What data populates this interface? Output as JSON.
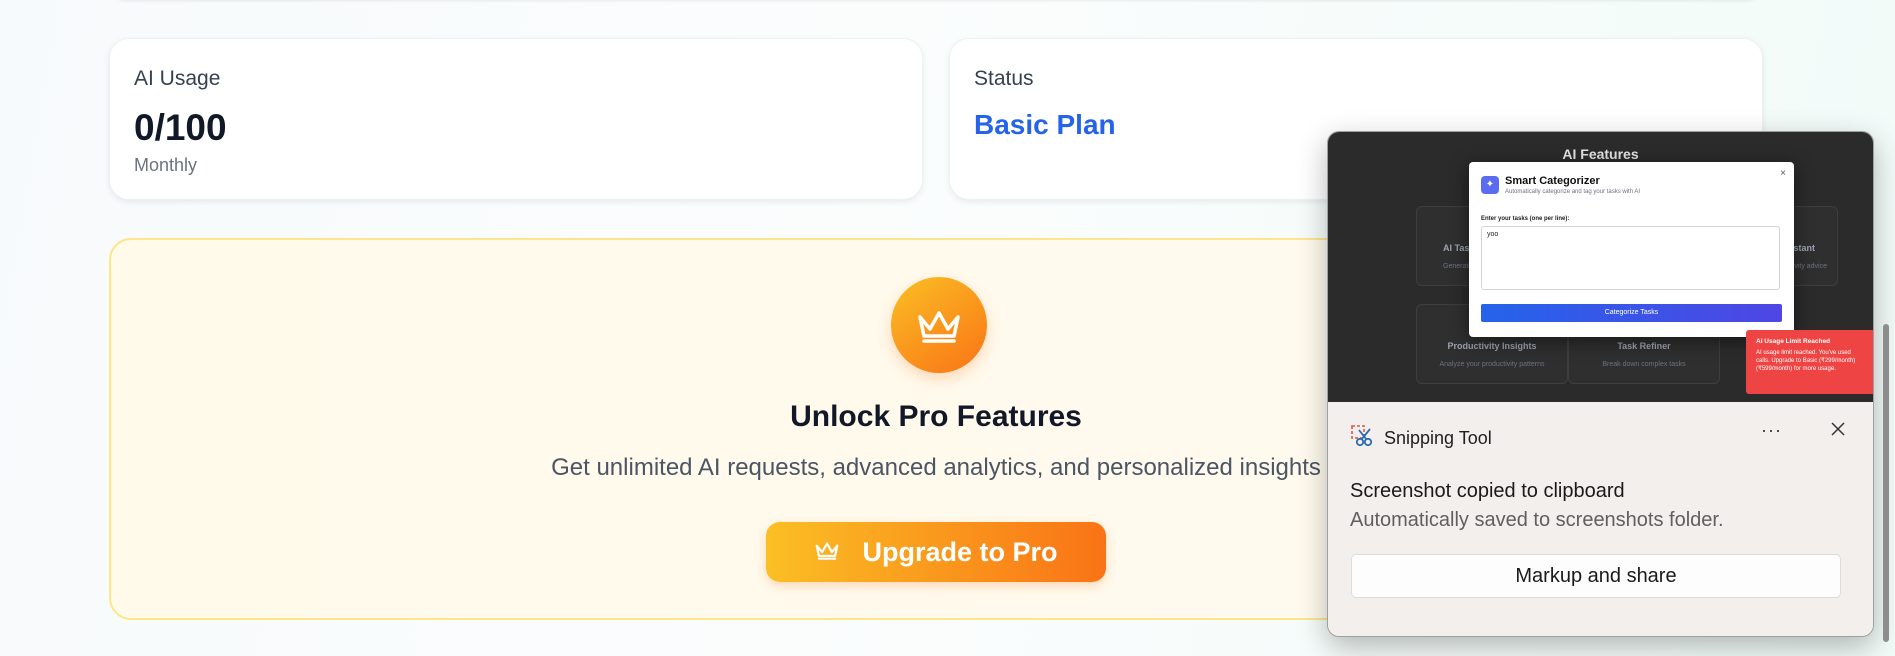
{
  "usage_card": {
    "label": "AI Usage",
    "value": "0/100",
    "period": "Monthly"
  },
  "status_card": {
    "label": "Status",
    "plan": "Basic Plan"
  },
  "promo": {
    "title": "Unlock Pro Features",
    "subtitle": "Get unlimited AI requests, advanced analytics, and personalized insights",
    "button_label": "Upgrade to Pro",
    "icon": "crown-icon",
    "accent_from": "#fbbf24",
    "accent_to": "#f97316"
  },
  "toast": {
    "app_name": "Snipping Tool",
    "more_label": "···",
    "title": "Screenshot copied to clipboard",
    "subtitle": "Automatically saved to screenshots folder.",
    "action_label": "Markup and share",
    "thumbnail": {
      "header": "AI Features",
      "modal_title": "Smart Categorizer",
      "modal_subtitle": "Automatically categorize and tag your tasks with AI",
      "modal_input_label": "Enter your tasks (one per line):",
      "modal_input_value": "yoo",
      "modal_button": "Categorize Tasks",
      "cards": [
        {
          "title": "AI Tas",
          "desc": "Generate"
        },
        {
          "title": "istant",
          "desc": "ctivity advice"
        },
        {
          "title": "Productivity Insights",
          "desc": "Analyze your productivity patterns"
        },
        {
          "title": "Task Refiner",
          "desc": "Break down complex tasks"
        }
      ],
      "alert_title": "AI Usage Limit Reached",
      "alert_text": "AI usage limit reached. You've used calls. Upgrade to Basic (₹299/month) (₹599/month) for more usage."
    }
  }
}
